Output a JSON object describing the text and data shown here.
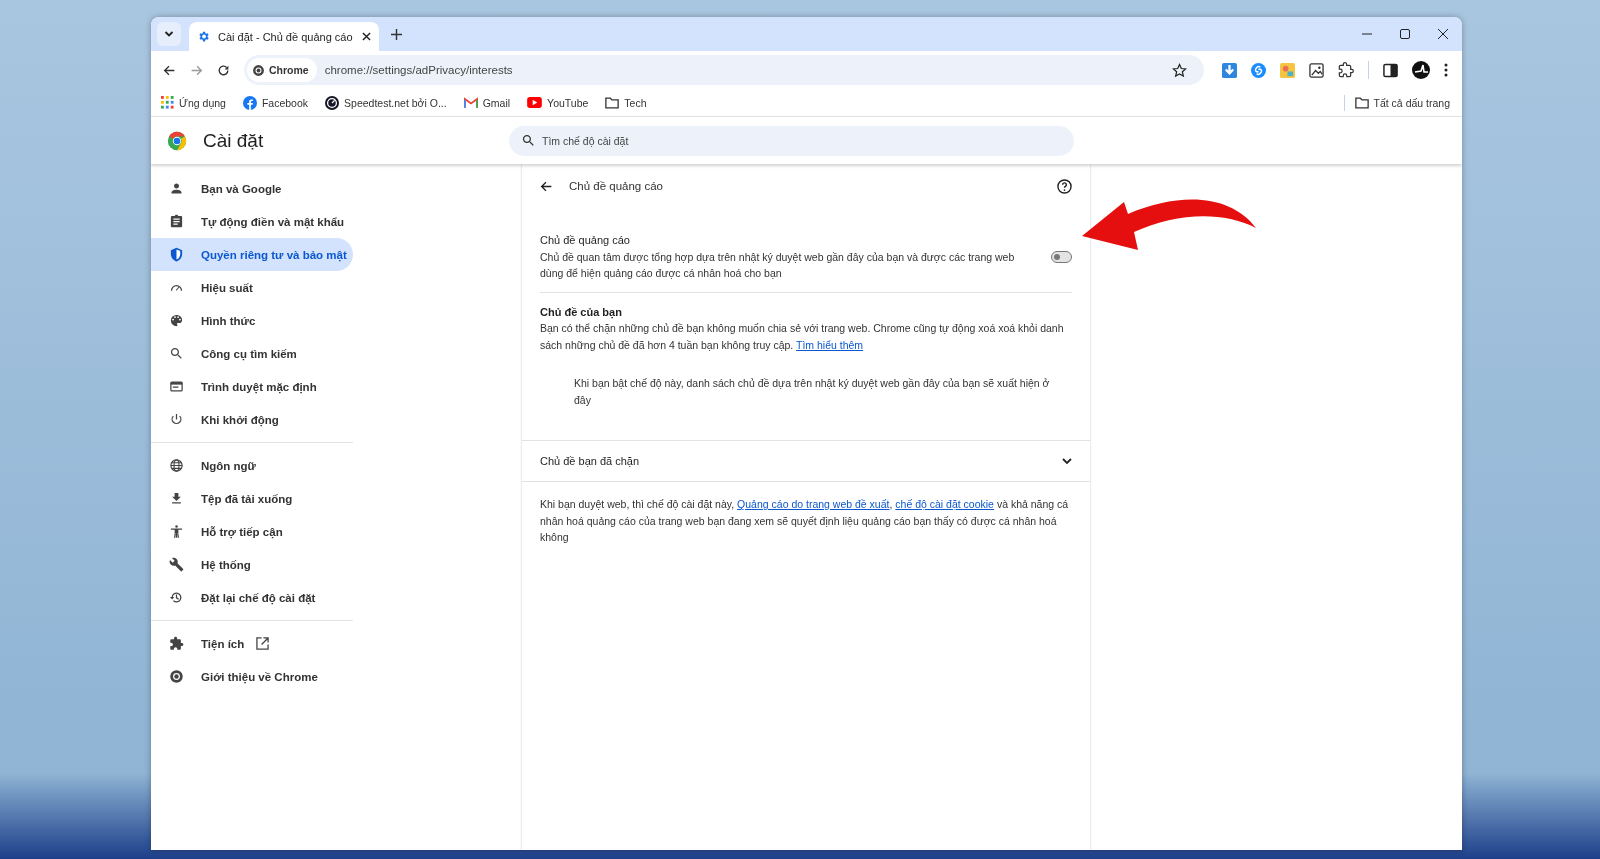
{
  "tabs": [
    {
      "title": "Cài đặt - Chủ đề quảng cáo",
      "selected": true
    }
  ],
  "toolbar": {
    "chip": "Chrome",
    "url": "chrome://settings/adPrivacy/interests"
  },
  "bookmarks": [
    {
      "label": "Ứng dụng"
    },
    {
      "label": "Facebook"
    },
    {
      "label": "Speedtest.net bởi O..."
    },
    {
      "label": "Gmail"
    },
    {
      "label": "YouTube"
    },
    {
      "label": "Tech"
    }
  ],
  "all_bookmarks": "Tất cả dấu trang",
  "header": {
    "title": "Cài đặt",
    "search_placeholder": "Tìm chế độ cài đặt"
  },
  "sidebar": {
    "groups": [
      [
        {
          "label": "Bạn và Google",
          "selected": false,
          "external": false
        },
        {
          "label": "Tự động điền và mật khẩu",
          "selected": false,
          "external": false
        },
        {
          "label": "Quyền riêng tư và bảo mật",
          "selected": true,
          "external": false
        },
        {
          "label": "Hiệu suất",
          "selected": false,
          "external": false
        },
        {
          "label": "Hình thức",
          "selected": false,
          "external": false
        },
        {
          "label": "Công cụ tìm kiếm",
          "selected": false,
          "external": false
        },
        {
          "label": "Trình duyệt mặc định",
          "selected": false,
          "external": false
        },
        {
          "label": "Khi khởi động",
          "selected": false,
          "external": false
        }
      ],
      [
        {
          "label": "Ngôn ngữ",
          "selected": false,
          "external": false
        },
        {
          "label": "Tệp đã tải xuống",
          "selected": false,
          "external": false
        },
        {
          "label": "Hỗ trợ tiếp cận",
          "selected": false,
          "external": false
        },
        {
          "label": "Hệ thống",
          "selected": false,
          "external": false
        },
        {
          "label": "Đặt lại chế độ cài đặt",
          "selected": false,
          "external": false
        }
      ],
      [
        {
          "label": "Tiện ích",
          "selected": false,
          "external": true
        },
        {
          "label": "Giới thiệu về Chrome",
          "selected": false,
          "external": false
        }
      ]
    ]
  },
  "page": {
    "title": "Chủ đề quảng cáo",
    "setting": {
      "title": "Chủ đề quảng cáo",
      "description": "Chủ đề quan tâm được tổng hợp dựa trên nhật ký duyệt web gần đây của bạn và được các trang web dùng để hiện quảng cáo được cá nhân hoá cho bạn",
      "on": false
    },
    "your_topics": {
      "title": "Chủ đề của bạn",
      "description": [
        {
          "kind": "text",
          "text": "Bạn có thể chặn những chủ đề bạn không muốn chia sẻ với trang web. Chrome cũng tự động xoá xoá khỏi danh sách những chủ đề đã hơn 4 tuần bạn không truy cập. "
        },
        {
          "kind": "link",
          "text": "Tìm hiểu thêm"
        }
      ],
      "empty_note": "Khi bạn bật chế độ này, danh sách chủ đề dựa trên nhật ký duyệt web gần đây của bạn sẽ xuất hiện ở đây"
    },
    "blocked": {
      "title": "Chủ đề bạn đã chặn",
      "expanded": false
    },
    "footer": [
      {
        "kind": "text",
        "text": "Khi bạn duyệt web, thì chế độ cài đặt này, "
      },
      {
        "kind": "link",
        "text": "Quảng cáo do trang web đề xuất"
      },
      {
        "kind": "text",
        "text": ", "
      },
      {
        "kind": "link",
        "text": "chế độ cài đặt cookie"
      },
      {
        "kind": "text",
        "text": " và khả năng cá nhân hoá quảng cáo của trang web bạn đang xem sẽ quyết định liệu quảng cáo bạn thấy có được cá nhân hoá không"
      }
    ]
  }
}
